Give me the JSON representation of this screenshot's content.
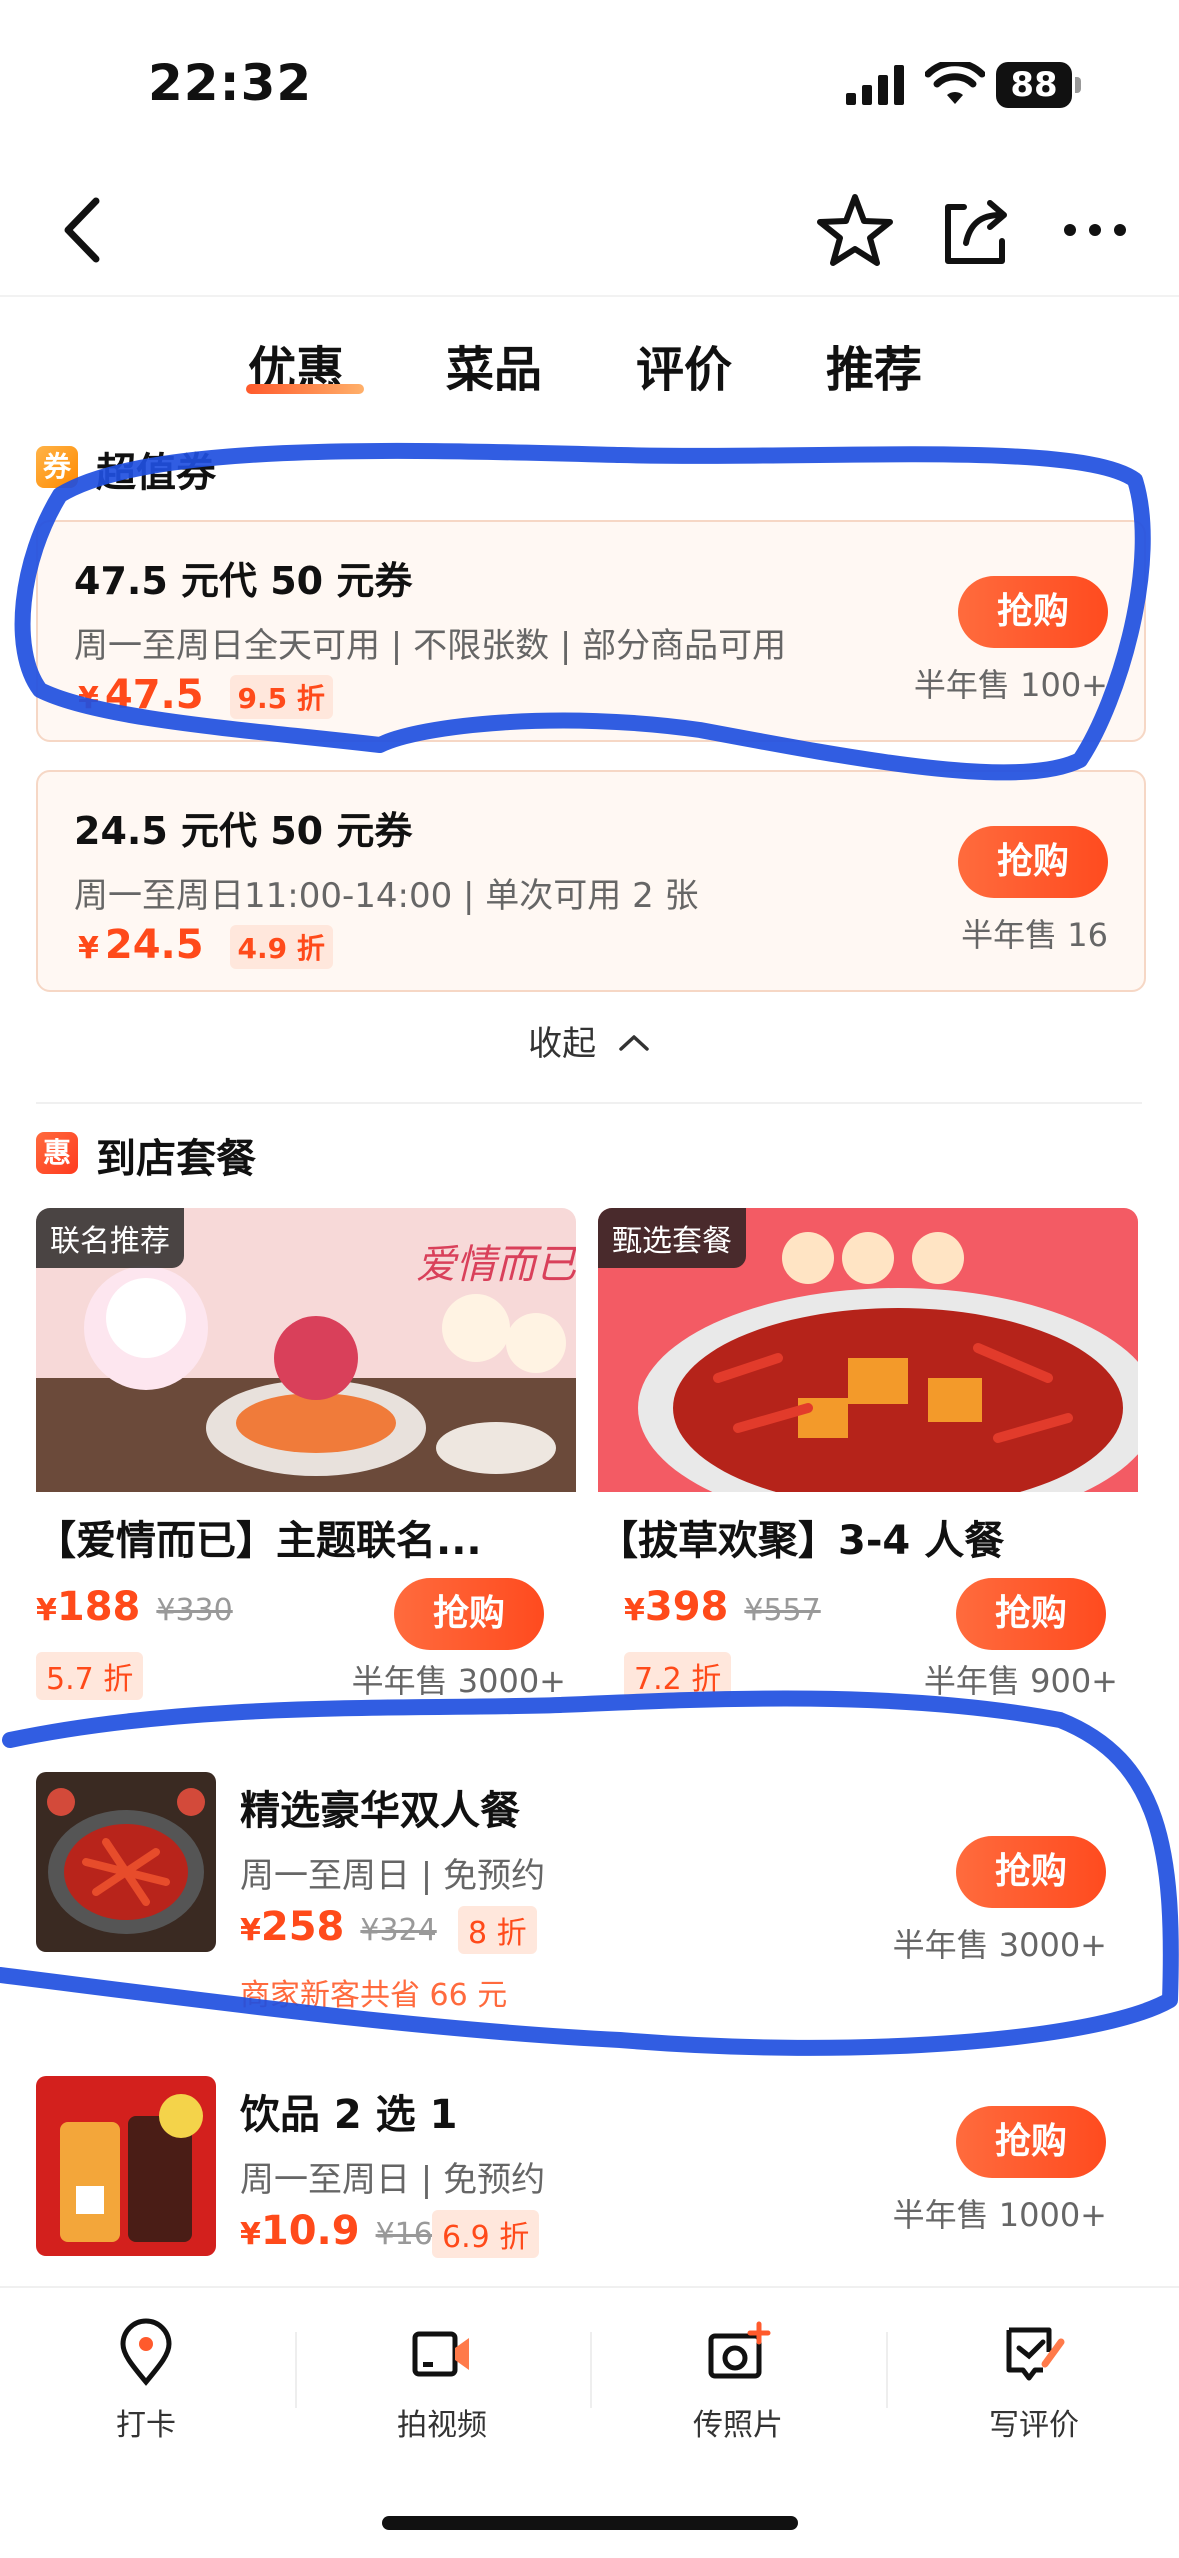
{
  "status_bar": {
    "time": "22:32",
    "battery": "88"
  },
  "tabs": [
    {
      "label": "优惠"
    },
    {
      "label": "菜品"
    },
    {
      "label": "评价"
    },
    {
      "label": "推荐"
    }
  ],
  "vouchers_section": {
    "icon_text": "券",
    "title": "超值券",
    "items": [
      {
        "title": "47.5 元代 50 元券",
        "sub": "周一至周日全天可用 | 不限张数 | 部分商品可用",
        "yen": "¥",
        "price": "47.5",
        "discount": "9.5 折",
        "buy": "抢购",
        "sold": "半年售 100+"
      },
      {
        "title": "24.5 元代 50 元券",
        "sub": "周一至周日11:00-14:00 | 单次可用 2 张",
        "yen": "¥",
        "price": "24.5",
        "discount": "4.9 折",
        "buy": "抢购",
        "sold": "半年售 16"
      }
    ],
    "collapse_label": "收起"
  },
  "packages_section": {
    "icon_text": "惠",
    "title": "到店套餐",
    "cards": [
      {
        "tag": "联名推荐",
        "title": "【爱情而已】主题联名...",
        "yen": "¥",
        "price": "188",
        "orig": "¥330",
        "discount": "5.7 折",
        "buy": "抢购",
        "sold": "半年售 3000+"
      },
      {
        "tag": "甄选套餐",
        "title": "【拔草欢聚】3-4 人餐",
        "yen": "¥",
        "price": "398",
        "orig": "¥557",
        "discount": "7.2 折",
        "buy": "抢购",
        "sold": "半年售 900+"
      }
    ],
    "rows": [
      {
        "title": "精选豪华双人餐",
        "sub": "周一至周日 | 免预约",
        "yen": "¥",
        "price": "258",
        "orig": "¥324",
        "discount": "8 折",
        "saving": "商家新客共省 66 元",
        "buy": "抢购",
        "sold": "半年售 3000+"
      },
      {
        "title": "饮品 2 选 1",
        "sub": "周一至周日 | 免预约",
        "yen": "¥",
        "price": "10.9",
        "orig": "¥16",
        "discount": "6.9 折",
        "buy": "抢购",
        "sold": "半年售 1000+"
      }
    ]
  },
  "bottom_bar": [
    {
      "label": "打卡",
      "icon": "location-pin-icon"
    },
    {
      "label": "拍视频",
      "icon": "video-camera-icon"
    },
    {
      "label": "传照片",
      "icon": "add-photo-icon"
    },
    {
      "label": "写评价",
      "icon": "write-review-icon"
    }
  ],
  "colors": {
    "accent": "#ff4b1f",
    "highlight": "#1f4fe0"
  }
}
